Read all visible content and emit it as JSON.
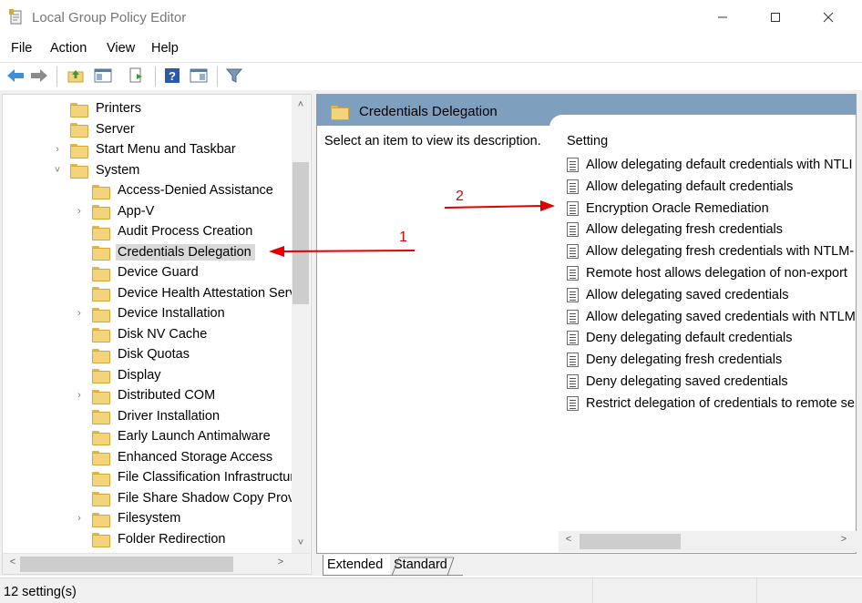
{
  "window": {
    "title": "Local Group Policy Editor",
    "icon": "policy-editor-icon",
    "controls": [
      "minimize-icon",
      "maximize-icon",
      "close-icon"
    ]
  },
  "menu": {
    "file": "File",
    "action": "Action",
    "view": "View",
    "help": "Help"
  },
  "toolbar": {
    "icons": [
      "back-arrow-icon",
      "forward-arrow-icon",
      "up-folder-icon",
      "show-hide-console-tree-icon",
      "export-list-icon",
      "help-icon",
      "show-hide-action-pane-icon",
      "filter-icon"
    ]
  },
  "tree": {
    "items": [
      {
        "label": "Printers",
        "level": 1,
        "expander": ""
      },
      {
        "label": "Server",
        "level": 1,
        "expander": ""
      },
      {
        "label": "Start Menu and Taskbar",
        "level": 1,
        "expander": "collapsed"
      },
      {
        "label": "System",
        "level": 1,
        "expander": "expanded"
      },
      {
        "label": "Access-Denied Assistance",
        "level": 2,
        "expander": ""
      },
      {
        "label": "App-V",
        "level": 2,
        "expander": "collapsed"
      },
      {
        "label": "Audit Process Creation",
        "level": 2,
        "expander": ""
      },
      {
        "label": "Credentials Delegation",
        "level": 2,
        "expander": "",
        "selected": true
      },
      {
        "label": "Device Guard",
        "level": 2,
        "expander": ""
      },
      {
        "label": "Device Health Attestation Serv",
        "level": 2,
        "expander": ""
      },
      {
        "label": "Device Installation",
        "level": 2,
        "expander": "collapsed"
      },
      {
        "label": "Disk NV Cache",
        "level": 2,
        "expander": ""
      },
      {
        "label": "Disk Quotas",
        "level": 2,
        "expander": ""
      },
      {
        "label": "Display",
        "level": 2,
        "expander": ""
      },
      {
        "label": "Distributed COM",
        "level": 2,
        "expander": "collapsed"
      },
      {
        "label": "Driver Installation",
        "level": 2,
        "expander": ""
      },
      {
        "label": "Early Launch Antimalware",
        "level": 2,
        "expander": ""
      },
      {
        "label": "Enhanced Storage Access",
        "level": 2,
        "expander": ""
      },
      {
        "label": "File Classification Infrastructur",
        "level": 2,
        "expander": ""
      },
      {
        "label": "File Share Shadow Copy Provi",
        "level": 2,
        "expander": ""
      },
      {
        "label": "Filesystem",
        "level": 2,
        "expander": "collapsed"
      },
      {
        "label": "Folder Redirection",
        "level": 2,
        "expander": ""
      }
    ]
  },
  "details": {
    "header_title": "Credentials Delegation",
    "description": "Select an item to view its description.",
    "column_setting": "Setting",
    "settings": [
      "Allow delegating default credentials with NTLI",
      "Allow delegating default credentials",
      "Encryption Oracle Remediation",
      "Allow delegating fresh credentials",
      "Allow delegating fresh credentials with NTLM-",
      "Remote host allows delegation of non-export",
      "Allow delegating saved credentials",
      "Allow delegating saved credentials with NTLM",
      "Deny delegating default credentials",
      "Deny delegating fresh credentials",
      "Deny delegating saved credentials",
      "Restrict delegation of credentials to remote se"
    ]
  },
  "tabs": {
    "extended": "Extended",
    "standard": "Standard"
  },
  "status": {
    "text": "12 setting(s)"
  },
  "annotations": {
    "label_1": "1",
    "label_2": "2",
    "color": "#e00000"
  },
  "colors": {
    "header_bar": "#7f9fbf",
    "selection": "#d9d9d9",
    "folder": "#f4d47a"
  }
}
